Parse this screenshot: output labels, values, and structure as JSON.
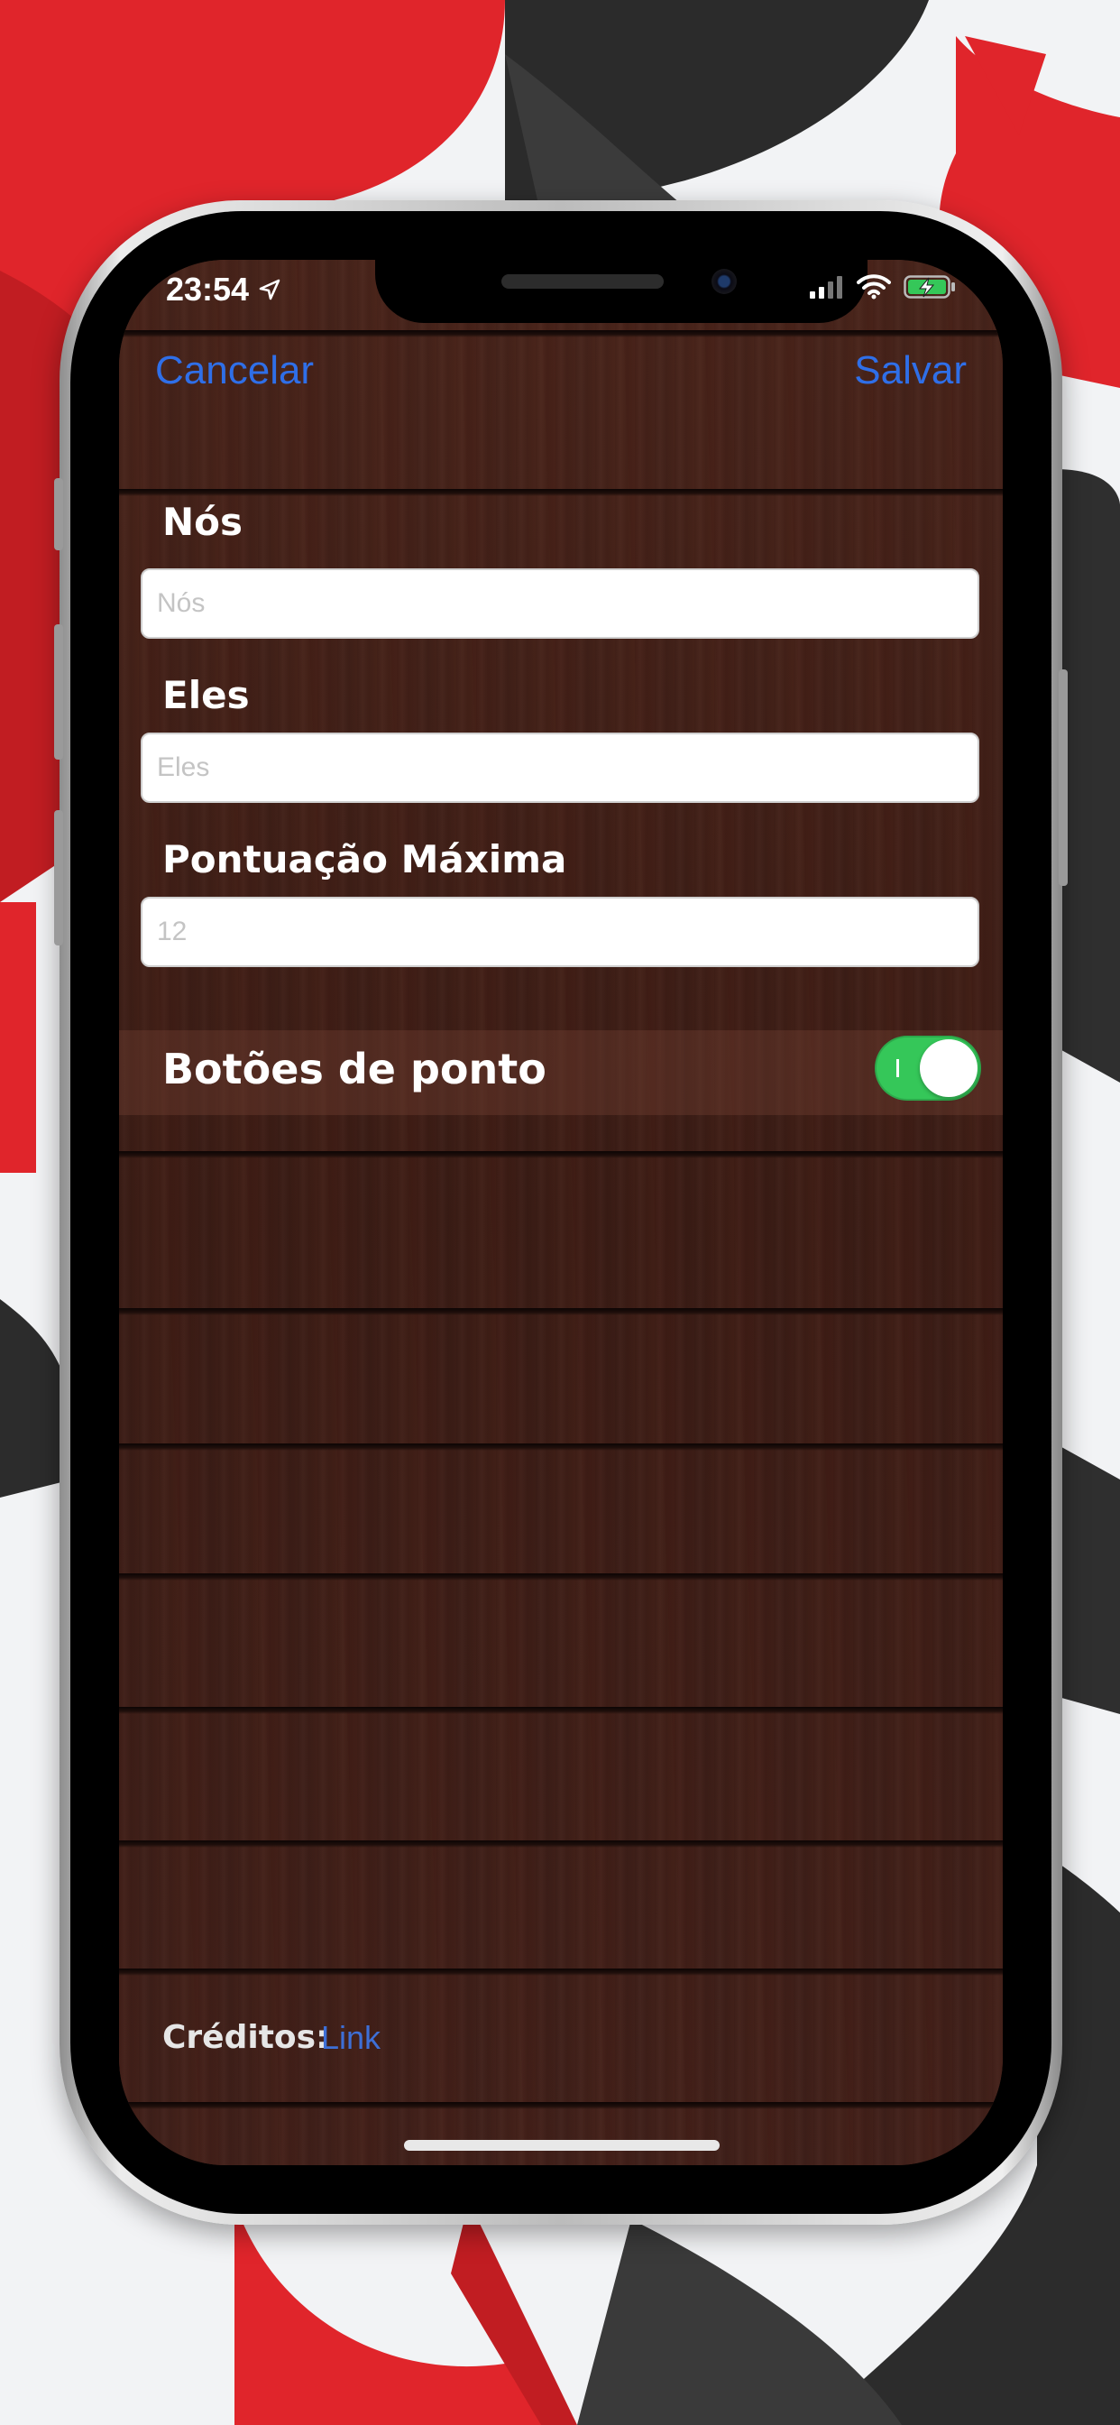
{
  "status_bar": {
    "time": "23:54",
    "location_icon": "location-arrow-icon",
    "signal_icon": "cellular-signal-icon",
    "wifi_icon": "wifi-icon",
    "battery_icon": "battery-charging-icon"
  },
  "nav": {
    "cancel_label": "Cancelar",
    "save_label": "Salvar"
  },
  "form": {
    "team_us": {
      "label": "Nós",
      "placeholder": "Nós",
      "value": ""
    },
    "team_them": {
      "label": "Eles",
      "placeholder": "Eles",
      "value": ""
    },
    "max_score": {
      "label": "Pontuação Máxima",
      "placeholder": "12",
      "value": ""
    },
    "point_buttons": {
      "label": "Botões de ponto",
      "enabled": true
    }
  },
  "footer": {
    "credits_label": "Créditos:",
    "link_label": "Link"
  },
  "colors": {
    "accent_blue": "#2f6fe8",
    "toggle_on": "#35c759",
    "wood_dark": "#3b1d16"
  }
}
